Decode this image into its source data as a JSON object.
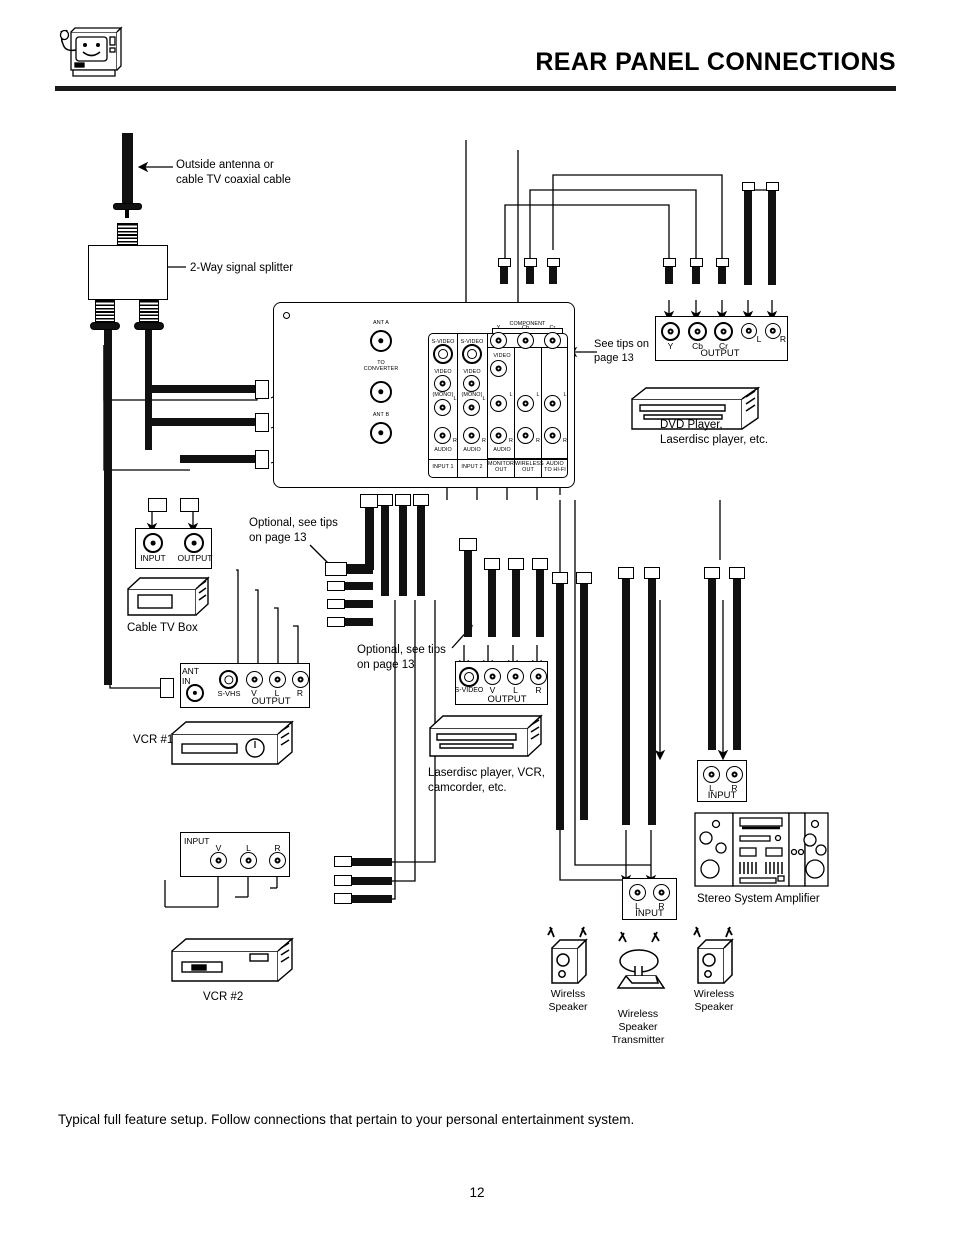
{
  "header": {
    "title": "REAR PANEL CONNECTIONS",
    "icon": "tv-with-plug-icon"
  },
  "footer": {
    "caption": "Typical full feature setup.  Follow connections that pertain to your personal entertainment system.",
    "page_number": "12"
  },
  "callouts": {
    "antenna": "Outside antenna or\ncable TV coaxial cable",
    "splitter": "2-Way signal splitter",
    "see_tips": "See tips on\npage 13",
    "optional_tips_1": "Optional, see tips\non page 13",
    "optional_tips_2": "Optional, see tips\non page 13"
  },
  "tv_panel": {
    "ant_a": "ANT A",
    "to_converter": "TO\nCONVERTER",
    "ant_b": "ANT B",
    "component_label": "COMPONENT",
    "component_jacks": [
      "Y",
      "Cb",
      "Cr"
    ],
    "row_labels": {
      "svideo": "S-VIDEO",
      "video": "VIDEO",
      "mono": "(MONO)",
      "left": "L",
      "right": "R",
      "audio": "AUDIO"
    },
    "columns": [
      {
        "name": "INPUT 1",
        "jacks": [
          "S-VIDEO",
          "VIDEO",
          "L",
          "R"
        ]
      },
      {
        "name": "INPUT 2",
        "jacks": [
          "S-VIDEO",
          "VIDEO",
          "L",
          "R"
        ]
      },
      {
        "name": "MONITOR\nOUT",
        "jacks": [
          "VIDEO",
          "L",
          "R"
        ]
      },
      {
        "name": "WIRELESS\nOUT",
        "jacks": [
          "L",
          "R"
        ]
      },
      {
        "name": "AUDIO\nTO HI-FI",
        "jacks": [
          "L",
          "R"
        ]
      }
    ]
  },
  "devices": {
    "dvd": {
      "label": "DVD Player,\nLaserdisc player, etc.",
      "output_label": "OUTPUT",
      "jacks": [
        "Y",
        "Cb",
        "Cr",
        "L",
        "R"
      ]
    },
    "cable_box": {
      "label": "Cable TV Box",
      "jacks": [
        "INPUT",
        "OUTPUT"
      ]
    },
    "vcr1": {
      "label": "VCR #1",
      "ant_in": "ANT\nIN",
      "output_label": "OUTPUT",
      "jacks": [
        "S-VHS",
        "V",
        "L",
        "R"
      ]
    },
    "vcr2": {
      "label": "VCR #2",
      "input_label": "INPUT",
      "jacks": [
        "V",
        "L",
        "R"
      ]
    },
    "laserdisc": {
      "label": "Laserdisc player, VCR,\ncamcorder, etc.",
      "output_label": "OUTPUT",
      "jacks": [
        "S-VIDEO",
        "V",
        "L",
        "R"
      ]
    },
    "amplifier": {
      "label": "Stereo System Amplifier",
      "input_top_label": "INPUT",
      "input_top_jacks": [
        "L",
        "R"
      ],
      "input_bottom_label": "INPUT",
      "input_bottom_jacks": [
        "L",
        "R"
      ]
    },
    "wireless_speaker_left": "Wirelss\nSpeaker",
    "wireless_speaker_right": "Wireless\nSpeaker",
    "wireless_transmitter": "Wireless\nSpeaker\nTransmitter",
    "speaker_input": {
      "label": "INPUT",
      "jacks": [
        "L",
        "R"
      ]
    }
  },
  "colors": {
    "ink": "#000000",
    "rule": "#1a1a1a",
    "paper": "#ffffff"
  }
}
